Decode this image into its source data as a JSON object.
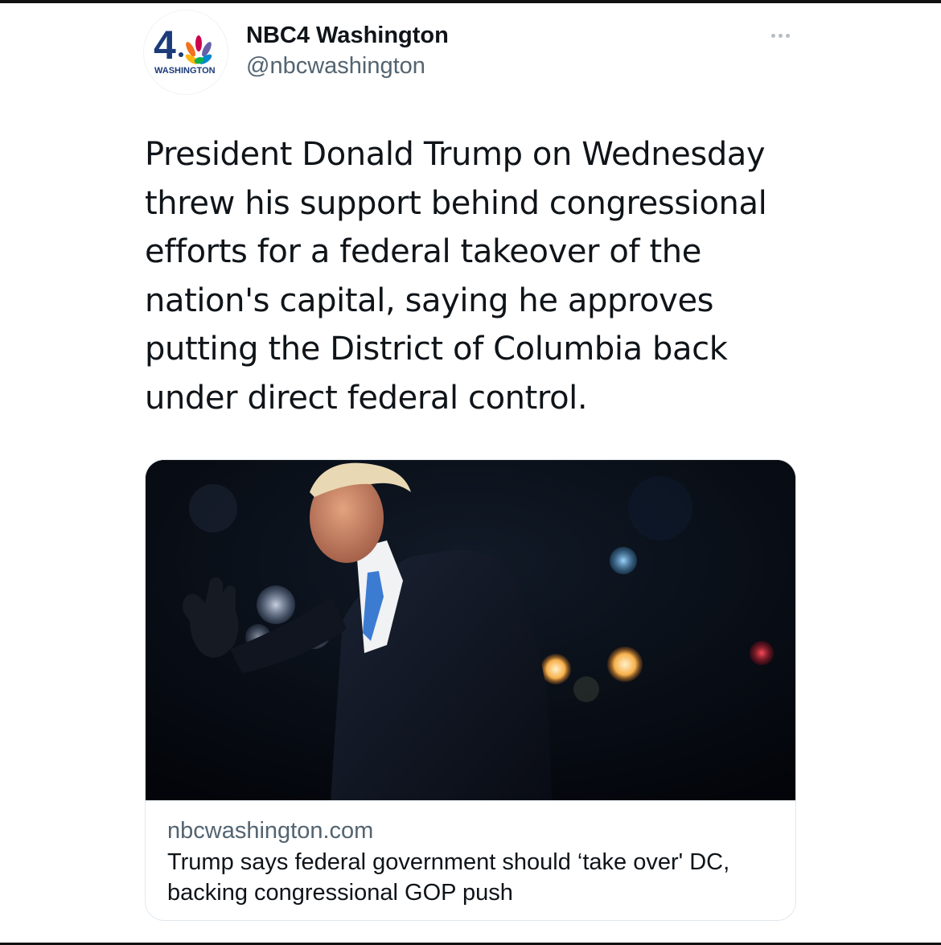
{
  "account": {
    "display_name": "NBC4 Washington",
    "handle": "@nbcwashington",
    "avatar_number": "4",
    "avatar_label": "WASHINGTON"
  },
  "tweet": {
    "text": "President Donald Trump on Wednesday\nthrew his support behind congressional\nefforts for a federal takeover of the\nnation's capital, saying he approves\nputting the District of Columbia back\nunder direct federal control."
  },
  "card": {
    "domain": "nbcwashington.com",
    "title": "Trump says federal government should ‘take over' DC, backing congressional GOP push",
    "image_icon": "photo-of-man-waving-at-night"
  },
  "icons": {
    "more": "more-options-icon",
    "logo": "nbc-peacock-icon"
  },
  "colors": {
    "text": "#0f1419",
    "secondary_text": "#536471",
    "border": "#e1e8ed"
  }
}
